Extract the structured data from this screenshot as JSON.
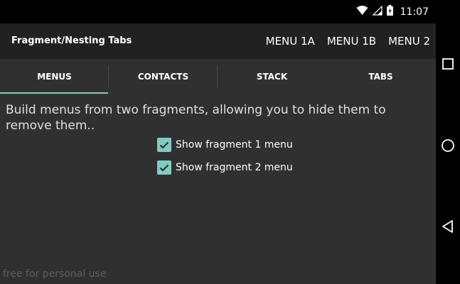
{
  "status_bar": {
    "time": "11:07",
    "icons": [
      "wifi-icon",
      "cell-signal-icon",
      "battery-charging-icon"
    ]
  },
  "action_bar": {
    "title": "Fragment/Nesting Tabs",
    "menu_items": [
      "MENU 1A",
      "MENU 1B",
      "MENU 2"
    ]
  },
  "tabs": {
    "items": [
      "MENUS",
      "CONTACTS",
      "STACK",
      "TABS"
    ],
    "selected": "MENUS",
    "indicator_color": "#80cbc4"
  },
  "content": {
    "description": "Build menus from two fragments, allowing you to hide them to remove them..",
    "checkboxes": [
      {
        "label": "Show fragment 1 menu",
        "checked": true
      },
      {
        "label": "Show fragment 2 menu",
        "checked": true
      }
    ]
  },
  "watermark": "free for personal use",
  "nav_bar": {
    "icons": [
      "recents-square-icon",
      "home-circle-icon",
      "back-triangle-icon"
    ]
  },
  "colors": {
    "background": "#303030",
    "action_bar": "#212121",
    "accent": "#80cbc4",
    "status_bar": "#000000"
  }
}
